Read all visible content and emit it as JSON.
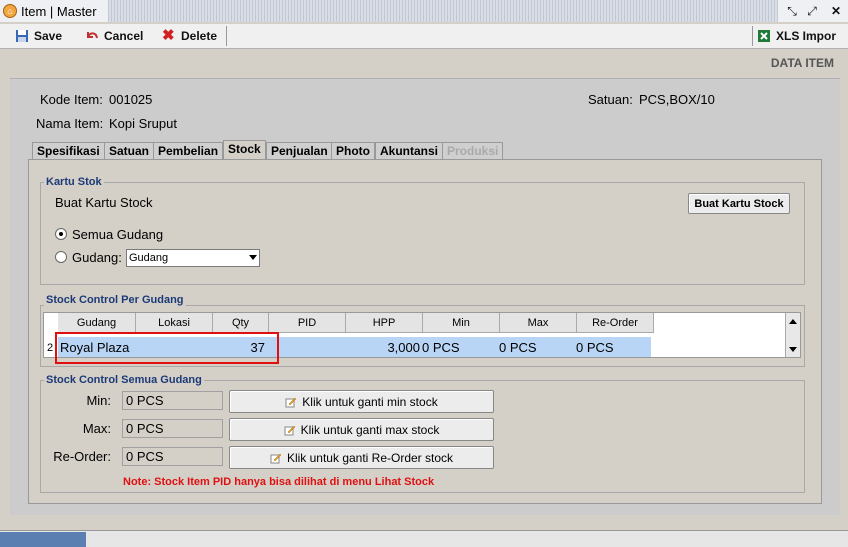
{
  "window": {
    "title": "Item | Master"
  },
  "toolbar": {
    "save": "Save",
    "cancel": "Cancel",
    "delete": "Delete",
    "xls_import": "XLS Impor"
  },
  "section_title": "DATA ITEM",
  "header": {
    "kode_label": "Kode Item:",
    "kode_value": "001025",
    "nama_label": "Nama Item:",
    "nama_value": "Kopi Sruput",
    "satuan_label": "Satuan:",
    "satuan_value": "PCS,BOX/10"
  },
  "tabs": [
    "Spesifikasi",
    "Satuan",
    "Pembelian",
    "Stock",
    "Penjualan",
    "Photo",
    "Akuntansi",
    "Produksi"
  ],
  "active_tab": "Stock",
  "kartu_stok": {
    "legend": "Kartu Stok",
    "text": "Buat Kartu Stock",
    "button": "Buat Kartu Stock",
    "radio_all": "Semua Gudang",
    "radio_gudang": "Gudang:",
    "gudang_select_value": "Gudang"
  },
  "per_gudang": {
    "legend": "Stock Control Per Gudang",
    "columns": [
      "Gudang",
      "Lokasi",
      "Qty",
      "PID",
      "HPP",
      "Min",
      "Max",
      "Re-Order"
    ],
    "row_index": "2",
    "row": {
      "gudang": "Royal Plaza",
      "lokasi": "",
      "qty": "37",
      "pid": "",
      "hpp": "3,000",
      "min": "0 PCS",
      "max": "0 PCS",
      "reorder": "0 PCS"
    }
  },
  "semua_gudang": {
    "legend": "Stock Control Semua Gudang",
    "min_label": "Min:",
    "min_value": "0 PCS",
    "max_label": "Max:",
    "max_value": "0 PCS",
    "reorder_label": "Re-Order:",
    "reorder_value": "0 PCS",
    "btn_min": "Klik untuk ganti min stock",
    "btn_max": "Klik untuk ganti max stock",
    "btn_reorder": "Klik untuk ganti Re-Order stock",
    "note": "Note: Stock Item PID hanya bisa dilihat di menu Lihat Stock"
  },
  "colors": {
    "note": "#e01010",
    "legend": "#1c3a78",
    "row_selected": "#b9d5f5",
    "highlight_box": "#e01010"
  }
}
